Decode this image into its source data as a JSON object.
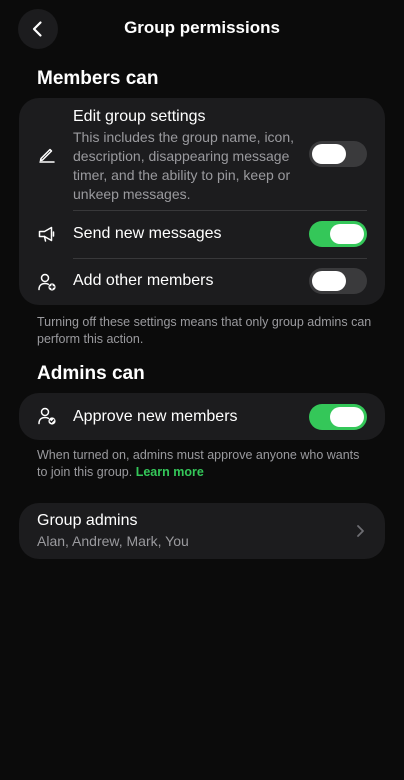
{
  "header": {
    "title": "Group permissions",
    "back_icon": "chevron-left-icon"
  },
  "members_section": {
    "title": "Members can",
    "items": [
      {
        "label": "Edit group settings",
        "description": "This includes the group name, icon, description, disappearing message timer, and the ability to pin, keep or unkeep messages.",
        "icon": "pencil-icon",
        "enabled": false
      },
      {
        "label": "Send new messages",
        "icon": "megaphone-icon",
        "enabled": true
      },
      {
        "label": "Add other members",
        "icon": "person-add-icon",
        "enabled": false
      }
    ],
    "footnote": "Turning off these settings means that only group admins can perform this action."
  },
  "admins_section": {
    "title": "Admins can",
    "items": [
      {
        "label": "Approve new members",
        "icon": "person-check-icon",
        "enabled": true
      }
    ],
    "footnote": "When turned on, admins must approve anyone who wants to join this group.",
    "learn_more": "Learn more"
  },
  "group_admins": {
    "label": "Group admins",
    "names": "Alan, Andrew, Mark, You"
  },
  "colors": {
    "background": "#0b0b0b",
    "card": "#1c1c1e",
    "accent": "#34c759",
    "secondary_text": "#9a9a9e"
  }
}
